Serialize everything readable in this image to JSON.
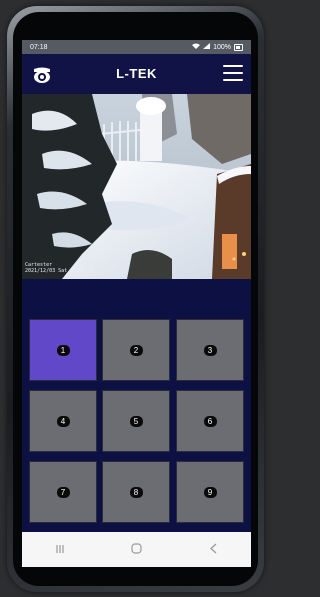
{
  "status_bar": {
    "time": "07:18",
    "battery": "100%"
  },
  "app_bar": {
    "brand": "L-TEK",
    "logo_icon": "camera-shield-icon",
    "menu_icon": "hamburger-menu-icon"
  },
  "camera": {
    "overlay_line1": "Cartester",
    "overlay_line2": "2021/12/03 Sat 08:18:16"
  },
  "grid": {
    "selected": "1",
    "tiles": [
      "1",
      "2",
      "3",
      "4",
      "5",
      "6",
      "7",
      "8",
      "9"
    ]
  },
  "nav_bar": {
    "buttons": [
      "recents-icon",
      "home-icon",
      "back-icon"
    ]
  },
  "colors": {
    "app_bar": "#111347",
    "grid_bg": "#0d1042",
    "tile": "#6b6d72",
    "tile_active": "#6048c8",
    "status_bar": "#565a63"
  }
}
